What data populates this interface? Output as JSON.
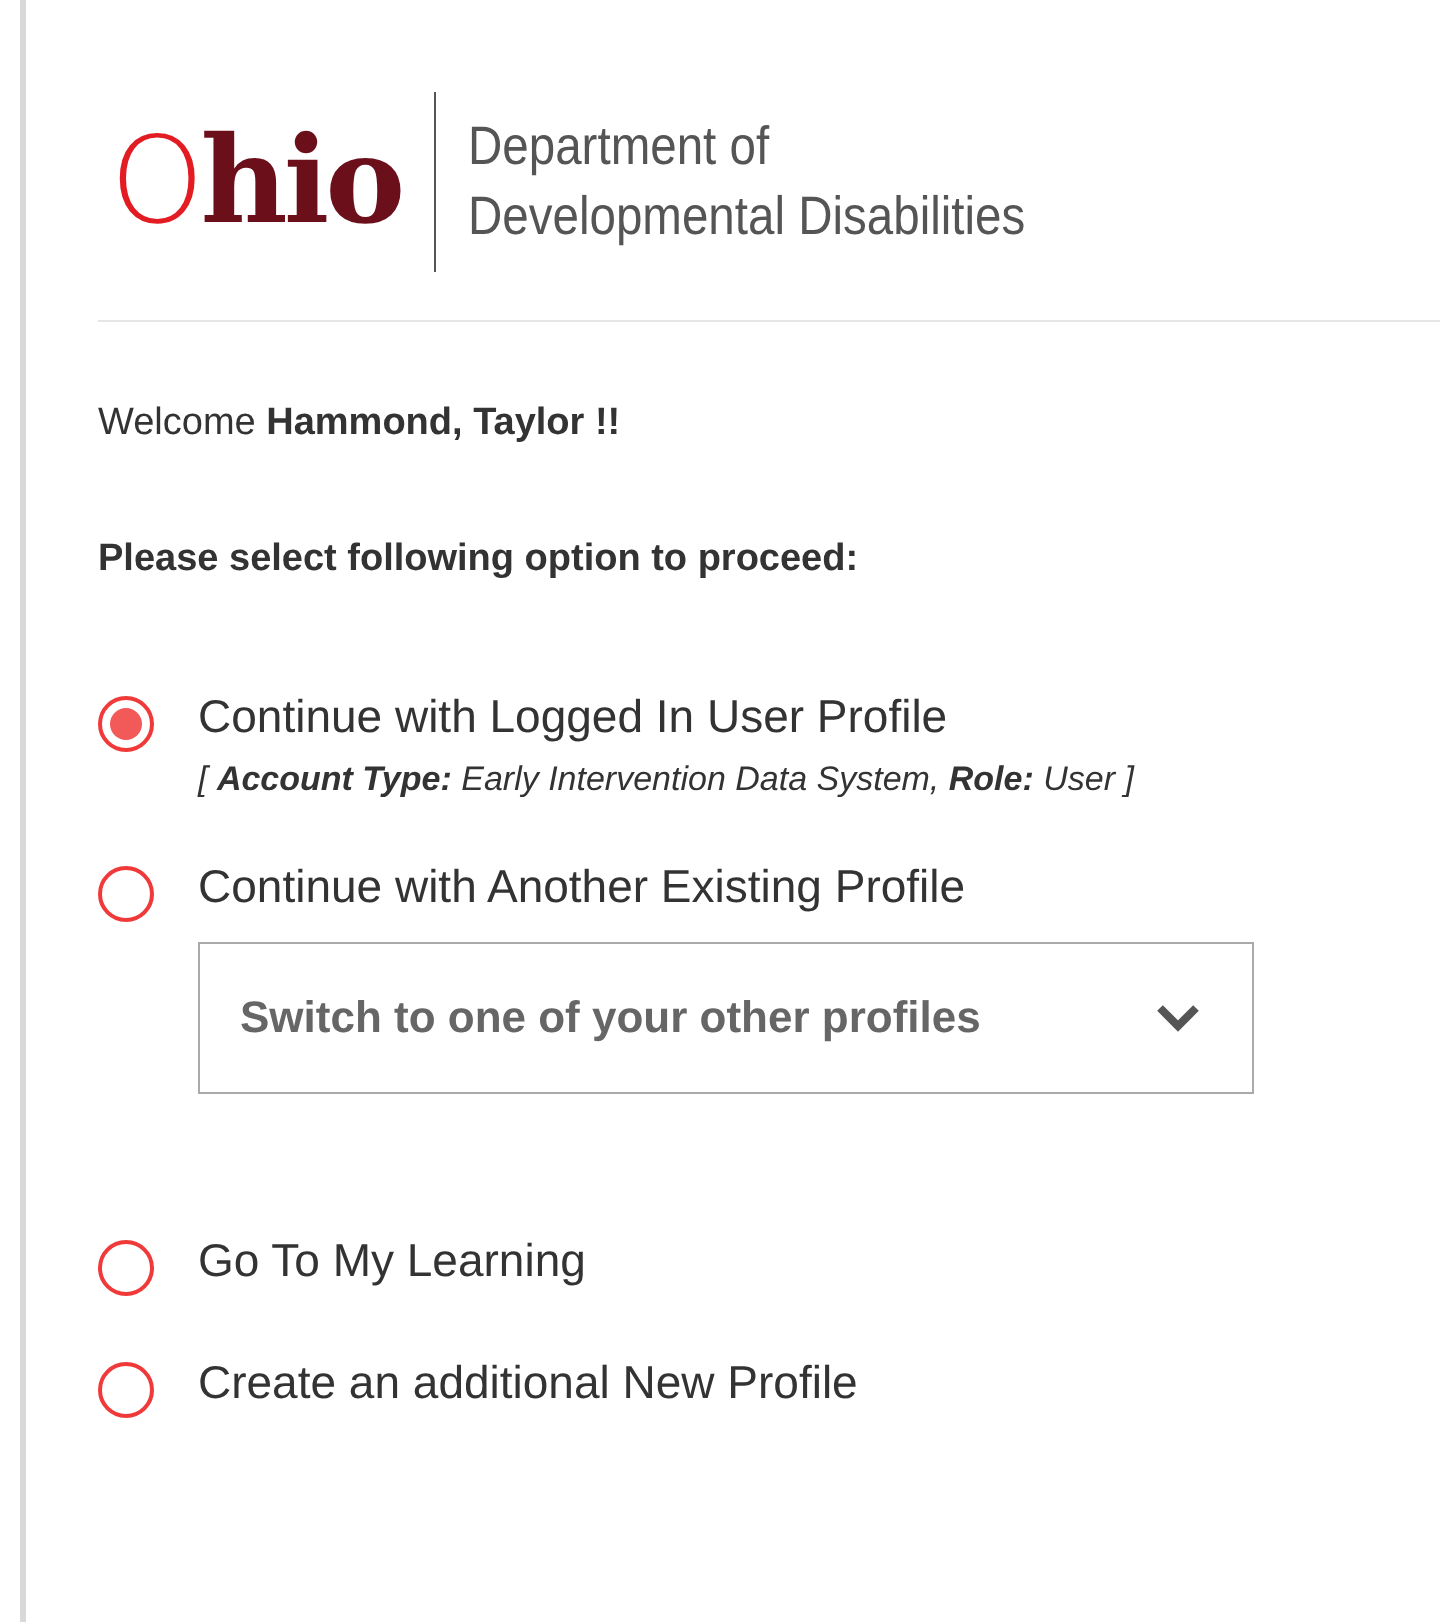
{
  "header": {
    "logo": "Ohio",
    "department": [
      "Department of",
      "Developmental Disabilities"
    ]
  },
  "welcome": "Welcome **Hammond, Taylor !!**",
  "prompt": "Please select following option to proceed:",
  "options": [
    {
      "label": "Continue with Logged In User Profile",
      "selected": true,
      "detail": "[ **Account Type:** Early Intervention Data System, **Role:** User ]"
    },
    {
      "label": "Continue with Another Existing Profile",
      "selected": false,
      "dropdown": {
        "placeholder": "Switch to one of your other profiles"
      }
    },
    {
      "label": "Go To My Learning",
      "selected": false
    },
    {
      "label": "Create an additional New Profile",
      "selected": false
    }
  ]
}
